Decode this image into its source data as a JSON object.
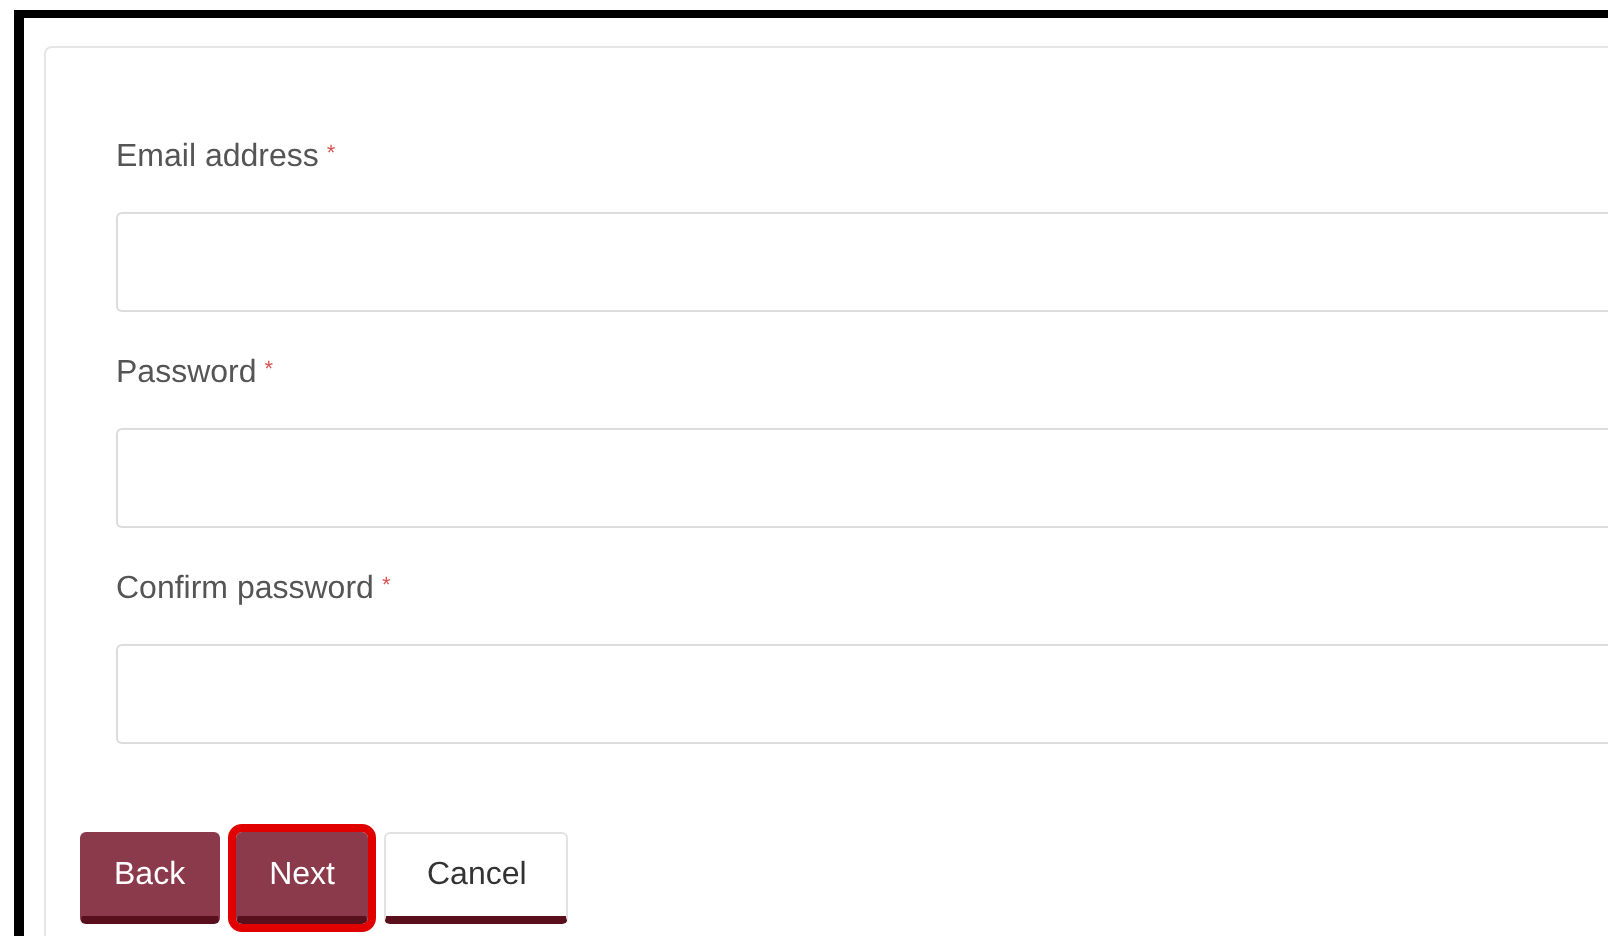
{
  "fields": [
    {
      "label": "Email address",
      "required_mark": "*"
    },
    {
      "label": "Password",
      "required_mark": "*"
    },
    {
      "label": "Confirm password",
      "required_mark": "*"
    }
  ],
  "buttons": [
    {
      "label": "Back",
      "kind": "primary",
      "highlighted": false
    },
    {
      "label": "Next",
      "kind": "primary",
      "highlighted": true
    },
    {
      "label": "Cancel",
      "kind": "secondary",
      "highlighted": false
    }
  ]
}
